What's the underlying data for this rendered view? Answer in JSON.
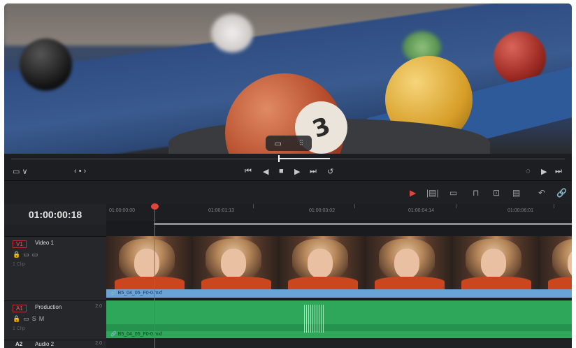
{
  "viewer": {
    "ball_number": "3",
    "overlay_icons": [
      "monitor-icon",
      "audio-waveform-icon"
    ]
  },
  "transport": {
    "left_icon": "▭ ∨",
    "nav": "‹ • ›",
    "controls": [
      "⏮",
      "◀",
      "■",
      "▶",
      "⏭",
      "↺"
    ],
    "right_icons": [
      "◌",
      "▶",
      "⏭"
    ]
  },
  "toolbar": {
    "icons": [
      "▶",
      "|▤|",
      "▭",
      "⊓",
      "⊡",
      "▤",
      "↶",
      "🔗"
    ]
  },
  "timeline": {
    "timecode": "01:00:00:18",
    "ruler_ticks": [
      "01:00:00:00",
      "01:00:01:13",
      "01:00:03:02",
      "01:00:04:14",
      "01:00:06:01"
    ]
  },
  "tracks": {
    "video1": {
      "badge": "V1",
      "name": "Video 1",
      "sub": "1 Clip",
      "icons": [
        "🔒",
        "▭",
        "▭"
      ]
    },
    "a1": {
      "badge": "A1",
      "name": "Production",
      "num": "2.0",
      "sub": "1 Clip",
      "icons": [
        "🔒",
        "▭",
        "S",
        "M"
      ]
    },
    "a2": {
      "badge": "A2",
      "name": "Audio 2",
      "num": "2.0"
    }
  },
  "clips": {
    "video_label": "🔗 B5_04_05_F0-0.mxf",
    "audio_label": "🔗 B5_04_05_F0-0.mxf"
  },
  "colors": {
    "accent_red": "#e0453d",
    "video_clip": "#6aa3d6",
    "audio_clip": "#2fa75a"
  }
}
